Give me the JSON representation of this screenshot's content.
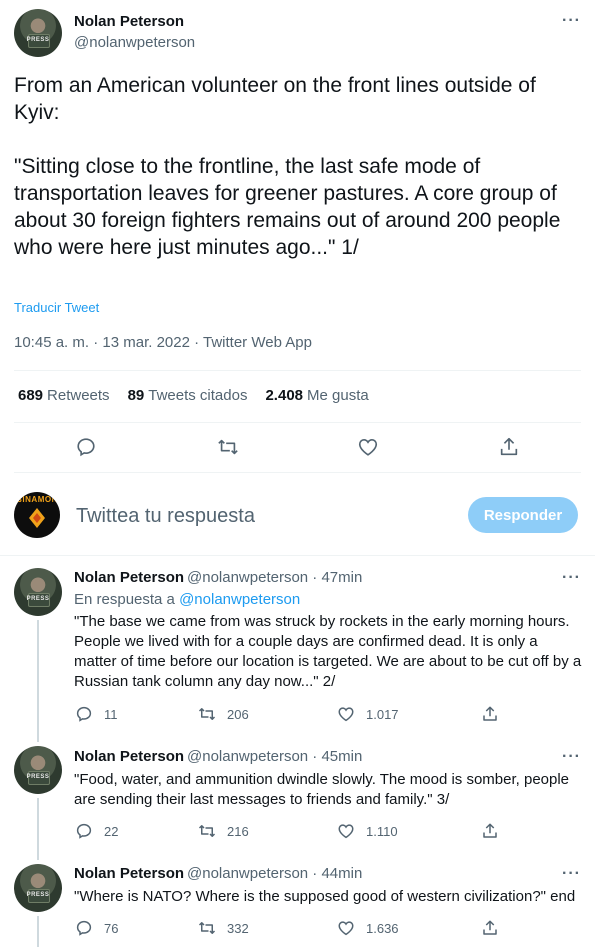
{
  "main_tweet": {
    "author_name": "Nolan Peterson",
    "author_handle": "@nolanwpeterson",
    "avatar_badge": "PRESS",
    "text": "From an American volunteer on the front lines outside of Kyiv:\n\n\"Sitting close to the frontline, the last safe mode of transportation leaves for greener pastures. A core group of about 30 foreign fighters remains out of around 200 people who were here just minutes ago...\" 1/",
    "translate_label": "Traducir Tweet",
    "meta": "10:45 a. m. · 13 mar. 2022 · Twitter Web App",
    "stats": {
      "retweets_count": "689",
      "retweets_label": "Retweets",
      "quotes_count": "89",
      "quotes_label": "Tweets citados",
      "likes_count": "2.408",
      "likes_label": "Me gusta"
    }
  },
  "compose": {
    "avatar_text": "BINAMON",
    "placeholder": "Twittea tu respuesta",
    "button_label": "Responder"
  },
  "replies": [
    {
      "author_name": "Nolan Peterson",
      "author_handle": "@nolanwpeterson · 47min",
      "in_reply_prefix": "En respuesta a",
      "in_reply_handle": "@nolanwpeterson",
      "text": "\"The base we came from was struck by rockets in the early morning hours. People we lived with for a couple days are confirmed dead. It is only a matter of time before our location is targeted. We are about to be cut off by a Russian tank column any day now...\" 2/",
      "replies": "11",
      "retweets": "206",
      "likes": "1.017"
    },
    {
      "author_name": "Nolan Peterson",
      "author_handle": "@nolanwpeterson · 45min",
      "text": "\"Food, water, and ammunition dwindle slowly. The mood is somber, people are sending their last messages to friends and family.\" 3/",
      "replies": "22",
      "retweets": "216",
      "likes": "1.110"
    },
    {
      "author_name": "Nolan Peterson",
      "author_handle": "@nolanwpeterson · 44min",
      "text": "\"Where is NATO? Where is the supposed good of western civilization?\" end",
      "replies": "76",
      "retweets": "332",
      "likes": "1.636"
    }
  ],
  "colors": {
    "accent": "#1d9bf0",
    "muted": "#536471",
    "button_disabled": "#8ecdf8"
  }
}
